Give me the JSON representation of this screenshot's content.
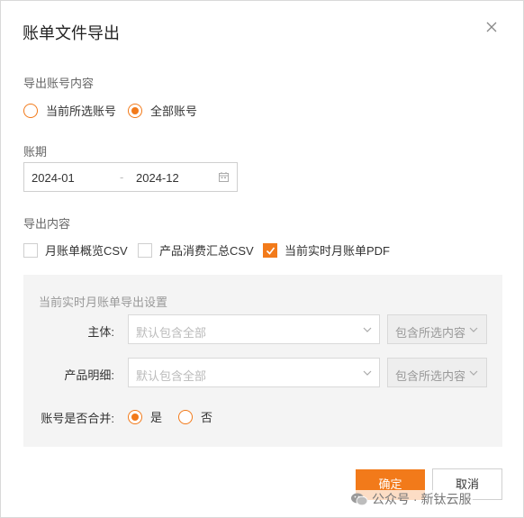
{
  "dialog": {
    "title": "账单文件导出"
  },
  "account_scope": {
    "label": "导出账号内容",
    "options": [
      {
        "label": "当前所选账号",
        "selected": false
      },
      {
        "label": "全部账号",
        "selected": true
      }
    ]
  },
  "period": {
    "label": "账期",
    "start": "2024-01",
    "separator": "-",
    "end": "2024-12"
  },
  "export_content": {
    "label": "导出内容",
    "options": [
      {
        "label": "月账单概览CSV",
        "checked": false
      },
      {
        "label": "产品消费汇总CSV",
        "checked": false
      },
      {
        "label": "当前实时月账单PDF",
        "checked": true
      }
    ]
  },
  "pdf_settings": {
    "title": "当前实时月账单导出设置",
    "entity": {
      "label": "主体:",
      "placeholder": "默认包含全部",
      "mode": "包含所选内容"
    },
    "product": {
      "label": "产品明细:",
      "placeholder": "默认包含全部",
      "mode": "包含所选内容"
    },
    "merge": {
      "label": "账号是否合并:",
      "options": [
        {
          "label": "是",
          "selected": true
        },
        {
          "label": "否",
          "selected": false
        }
      ]
    }
  },
  "buttons": {
    "confirm": "确定",
    "cancel": "取消"
  },
  "watermark": {
    "text": "公众号 · 新钛云服",
    "icon": "wechat-icon"
  },
  "colors": {
    "accent": "#f27a1a",
    "panel_bg": "#f4f4f4"
  }
}
